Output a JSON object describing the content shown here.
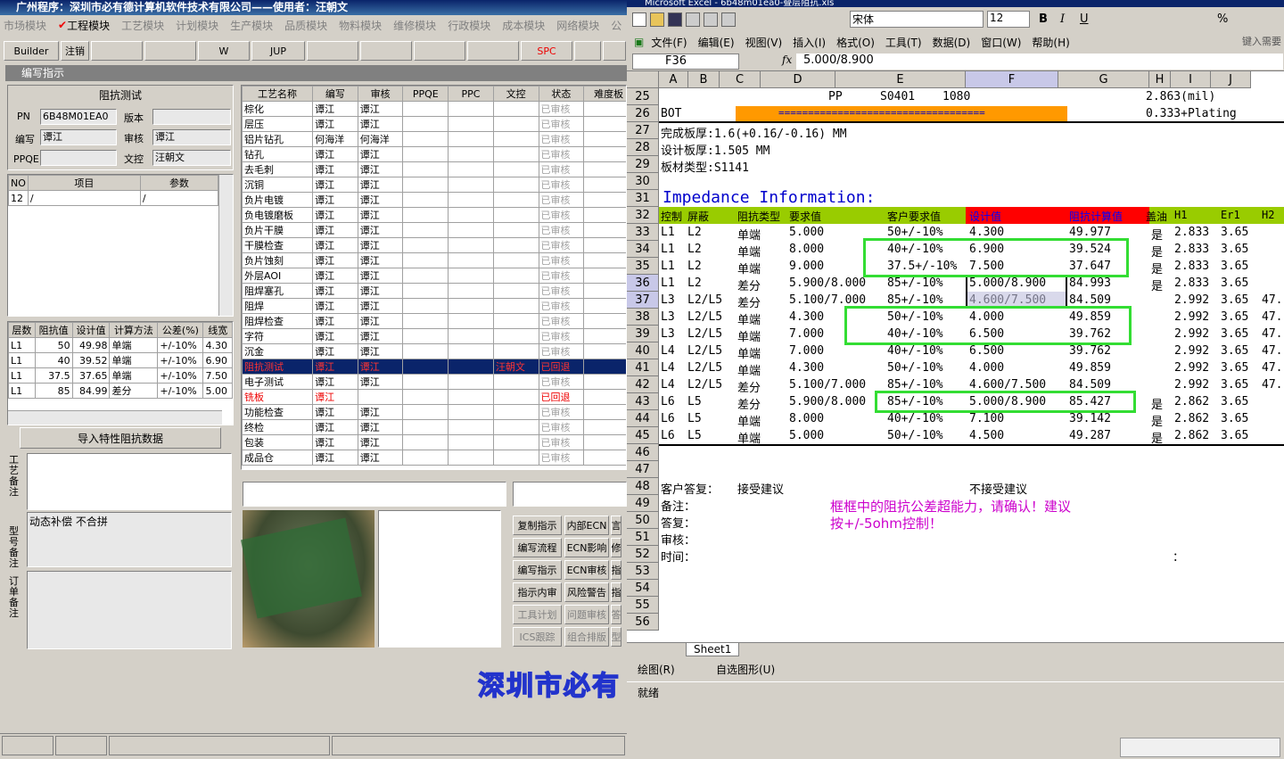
{
  "app": {
    "title": "广州程序：深圳市必有德计算机软件技术有限公司——使用者：汪朝文",
    "modules": [
      "市场模块",
      "工程模块",
      "工艺模块",
      "计划模块",
      "生产模块",
      "品质模块",
      "物料模块",
      "维修模块",
      "行政模块",
      "成本模块",
      "网络模块",
      "公"
    ],
    "active_module": "工程模块",
    "toolbar": [
      "Builder",
      "注销",
      "",
      "",
      "W",
      "JUP",
      "",
      "",
      "",
      "",
      "SPC",
      "",
      ""
    ],
    "window_title": "编写指示"
  },
  "form": {
    "title": "阻抗测试",
    "pn_label": "PN",
    "pn_value": "6B48M01EA0",
    "version_label": "版本",
    "version_value": "",
    "writer_label": "编写",
    "writer_value": "谭江",
    "review_label": "审核",
    "review_value": "谭江",
    "ppqe_label": "PPQE",
    "ppqe_value": "",
    "wenkong_label": "文控",
    "wenkong_value": "汪朝文"
  },
  "items_table": {
    "headers": [
      "NO",
      "项目",
      "参数"
    ],
    "rows": [
      [
        "12",
        "/",
        "/"
      ]
    ]
  },
  "imp_table": {
    "headers": [
      "层数",
      "阻抗值",
      "设计值",
      "计算方法",
      "公差(%)",
      "线宽"
    ],
    "rows": [
      [
        "L1",
        "50",
        "49.98",
        "单端",
        "+/-10%",
        "4.30"
      ],
      [
        "L1",
        "40",
        "39.52",
        "单端",
        "+/-10%",
        "6.90"
      ],
      [
        "L1",
        "37.5",
        "37.65",
        "单端",
        "+/-10%",
        "7.50"
      ],
      [
        "L1",
        "85",
        "84.99",
        "差分",
        "+/-10%",
        "5.00"
      ]
    ]
  },
  "import_button": "导入特性阻抗数据",
  "notes": {
    "process_label": "工艺备注",
    "model_label": "型号备注",
    "model_value": "动态补偿 不合拼",
    "order_label": "订单备注"
  },
  "process_table": {
    "headers": [
      "工艺名称",
      "编写",
      "审核",
      "PPQE",
      "PPC",
      "文控",
      "状态",
      "难度板"
    ],
    "rows": [
      [
        "棕化",
        "谭江",
        "谭江",
        "",
        "",
        "",
        "已审核"
      ],
      [
        "层压",
        "谭江",
        "谭江",
        "",
        "",
        "",
        "已审核"
      ],
      [
        "铝片钻孔",
        "何海洋",
        "何海洋",
        "",
        "",
        "",
        "已审核"
      ],
      [
        "钻孔",
        "谭江",
        "谭江",
        "",
        "",
        "",
        "已审核"
      ],
      [
        "去毛刺",
        "谭江",
        "谭江",
        "",
        "",
        "",
        "已审核"
      ],
      [
        "沉铜",
        "谭江",
        "谭江",
        "",
        "",
        "",
        "已审核"
      ],
      [
        "负片电镀",
        "谭江",
        "谭江",
        "",
        "",
        "",
        "已审核"
      ],
      [
        "负电镀磨板",
        "谭江",
        "谭江",
        "",
        "",
        "",
        "已审核"
      ],
      [
        "负片干膜",
        "谭江",
        "谭江",
        "",
        "",
        "",
        "已审核"
      ],
      [
        "干膜检查",
        "谭江",
        "谭江",
        "",
        "",
        "",
        "已审核"
      ],
      [
        "负片蚀刻",
        "谭江",
        "谭江",
        "",
        "",
        "",
        "已审核"
      ],
      [
        "外层AOI",
        "谭江",
        "谭江",
        "",
        "",
        "",
        "已审核"
      ],
      [
        "阻焊塞孔",
        "谭江",
        "谭江",
        "",
        "",
        "",
        "已审核"
      ],
      [
        "阻焊",
        "谭江",
        "谭江",
        "",
        "",
        "",
        "已审核"
      ],
      [
        "阻焊检查",
        "谭江",
        "谭江",
        "",
        "",
        "",
        "已审核"
      ],
      [
        "字符",
        "谭江",
        "谭江",
        "",
        "",
        "",
        "已审核"
      ],
      [
        "沉金",
        "谭江",
        "谭江",
        "",
        "",
        "",
        "已审核"
      ],
      [
        "阻抗测试",
        "谭江",
        "谭江",
        "",
        "",
        "汪朝文",
        "已回退"
      ],
      [
        "电子测试",
        "谭江",
        "谭江",
        "",
        "",
        "",
        "已审核"
      ],
      [
        "铣板",
        "谭江",
        "",
        "",
        "",
        "",
        "已回退"
      ],
      [
        "功能检查",
        "谭江",
        "谭江",
        "",
        "",
        "",
        "已审核"
      ],
      [
        "终检",
        "谭江",
        "谭江",
        "",
        "",
        "",
        "已审核"
      ],
      [
        "包装",
        "谭江",
        "谭江",
        "",
        "",
        "",
        "已审核"
      ],
      [
        "成品仓",
        "谭江",
        "谭江",
        "",
        "",
        "",
        "已审核"
      ]
    ]
  },
  "side_buttons": [
    [
      "复制指示",
      "内部ECN",
      "言"
    ],
    [
      "编写流程",
      "ECN影响",
      "修"
    ],
    [
      "编写指示",
      "ECN审核",
      "指"
    ],
    [
      "指示内审",
      "风险警告",
      "指"
    ],
    [
      "工具计划",
      "问题审核",
      "答"
    ],
    [
      "ICS跟踪",
      "组合排版",
      "型"
    ]
  ],
  "banner": "深圳市必有",
  "excel": {
    "title": "Microsoft Excel - 6b48m01ea0-叠层阻抗.xls",
    "font_name": "宋体",
    "font_size": "12",
    "menus": [
      "文件(F)",
      "编辑(E)",
      "视图(V)",
      "插入(I)",
      "格式(O)",
      "工具(T)",
      "数据(D)",
      "窗口(W)",
      "帮助(H)"
    ],
    "help_hint": "键入需要",
    "name_box": "F36",
    "formula": "5.000/8.900",
    "columns": [
      "A",
      "B",
      "C",
      "D",
      "E",
      "F",
      "G",
      "H",
      "I",
      "J"
    ],
    "row_numbers": [
      "25",
      "26",
      "27",
      "28",
      "29",
      "30",
      "31",
      "32",
      "33",
      "34",
      "35",
      "36",
      "37",
      "38",
      "39",
      "40",
      "41",
      "42",
      "43",
      "44",
      "45",
      "46",
      "47",
      "48",
      "49",
      "50",
      "51",
      "52",
      "53",
      "54",
      "55",
      "56"
    ],
    "r25": {
      "d": "PP",
      "e1": "S0401",
      "e2": "1080",
      "h": "2.863(mil)"
    },
    "r26": {
      "a": "BOT",
      "eq": "===================================",
      "h": "0.333+Plating"
    },
    "r27": "完成板厚:1.6(+0.16/-0.16) MM",
    "r28": "设计板厚:1.505 MM",
    "r29": "板材类型:S1141",
    "r31": "Impedance Information:",
    "header_row": [
      "控制",
      "屏蔽",
      "阻抗类型",
      "要求值",
      "客户要求值",
      "设计值",
      "阻抗计算值",
      "盖油",
      "H1",
      "Er1",
      "H2"
    ],
    "data_rows": [
      [
        "L1",
        "L2",
        "单端",
        "5.000",
        "50+/-10%",
        "4.300",
        "49.977",
        "是",
        "2.833",
        "3.65",
        ""
      ],
      [
        "L1",
        "L2",
        "单端",
        "8.000",
        "40+/-10%",
        "6.900",
        "39.524",
        "是",
        "2.833",
        "3.65",
        ""
      ],
      [
        "L1",
        "L2",
        "单端",
        "9.000",
        "37.5+/-10%",
        "7.500",
        "37.647",
        "是",
        "2.833",
        "3.65",
        ""
      ],
      [
        "L1",
        "L2",
        "差分",
        "5.900/8.000",
        "85+/-10%",
        "5.000/8.900",
        "84.993",
        "是",
        "2.833",
        "3.65",
        ""
      ],
      [
        "L3",
        "L2/L5",
        "差分",
        "5.100/7.000",
        "85+/-10%",
        "4.600/7.500",
        "84.509",
        "",
        "2.992",
        "3.65",
        "47."
      ],
      [
        "L3",
        "L2/L5",
        "单端",
        "4.300",
        "50+/-10%",
        "4.000",
        "49.859",
        "",
        "2.992",
        "3.65",
        "47."
      ],
      [
        "L3",
        "L2/L5",
        "单端",
        "7.000",
        "40+/-10%",
        "6.500",
        "39.762",
        "",
        "2.992",
        "3.65",
        "47."
      ],
      [
        "L4",
        "L2/L5",
        "单端",
        "7.000",
        "40+/-10%",
        "6.500",
        "39.762",
        "",
        "2.992",
        "3.65",
        "47."
      ],
      [
        "L4",
        "L2/L5",
        "单端",
        "4.300",
        "50+/-10%",
        "4.000",
        "49.859",
        "",
        "2.992",
        "3.65",
        "47."
      ],
      [
        "L4",
        "L2/L5",
        "差分",
        "5.100/7.000",
        "85+/-10%",
        "4.600/7.500",
        "84.509",
        "",
        "2.992",
        "3.65",
        "47."
      ],
      [
        "L6",
        "L5",
        "差分",
        "5.900/8.000",
        "85+/-10%",
        "5.000/8.900",
        "85.427",
        "是",
        "2.862",
        "3.65",
        ""
      ],
      [
        "L6",
        "L5",
        "单端",
        "8.000",
        "40+/-10%",
        "7.100",
        "39.142",
        "是",
        "2.862",
        "3.65",
        ""
      ],
      [
        "L6",
        "L5",
        "单端",
        "5.000",
        "50+/-10%",
        "4.500",
        "49.287",
        "是",
        "2.862",
        "3.65",
        ""
      ]
    ],
    "r48": {
      "a": "客户答复：",
      "b": "接受建议",
      "f": "不接受建议"
    },
    "r49": "备注：",
    "r50": "答复：",
    "r51": "审核：",
    "r52": "时间：",
    "r52_colon": "：",
    "note": [
      "框框中的阻抗公差超能力，请确认！建议",
      "按+/-5ohm控制！"
    ],
    "sheet_tab": "Sheet1",
    "draw_toolbar": [
      "绘图(R)",
      "自选图形(U)"
    ],
    "status": "就绪",
    "colors": {
      "header_green": "#99cc00",
      "design_red": "#ff0000",
      "orange": "#ff9900",
      "box_green": "#33dd33",
      "note_magenta": "#cc00cc"
    }
  }
}
